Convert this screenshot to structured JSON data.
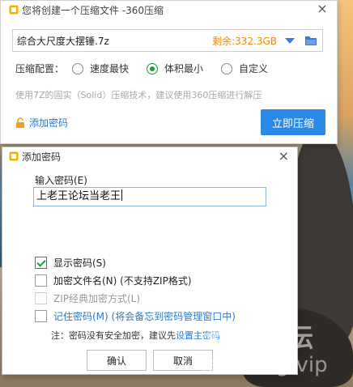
{
  "main_window": {
    "title": "您将创建一个压缩文件 -360压缩",
    "close": "×",
    "archive_name": "综合大尺度大摆锤.7z",
    "remaining_space": "剩余:332.3GB",
    "level_label": "压缩配置：",
    "levels": [
      {
        "label": "速度最快",
        "selected": false
      },
      {
        "label": "体积最小",
        "selected": true
      },
      {
        "label": "自定义",
        "selected": false
      }
    ],
    "hint": "使用7Z的固实（Solid）压缩技术，建议使用360压缩进行解压",
    "add_password_link": "添加密码",
    "compress_button": "立即压缩"
  },
  "password_dialog": {
    "title": "添加密码",
    "close": "×",
    "input_label": "输入密码(E)",
    "password_value": "上老王论坛当老王",
    "options": [
      {
        "label": "显示密码(S)",
        "checked": true,
        "disabled": false
      },
      {
        "label": "加密文件名(N) (不支持ZIP格式)",
        "checked": false,
        "disabled": false
      },
      {
        "label": "ZIP经典加密方式(L)",
        "checked": false,
        "disabled": true
      },
      {
        "label": "记住密码(M) (将会备忘到密码管理窗口中)",
        "checked": false,
        "disabled": false
      }
    ],
    "note_prefix": "注：密码没有安全加密，建议先",
    "note_link": "设置主密码",
    "ok_button": "确认",
    "cancel_button": "取消"
  },
  "watermark": {
    "line1": "老王论坛",
    "line2": "laowang.vip"
  },
  "colors": {
    "accent": "#2b8ae6",
    "remaining": "#f08a00",
    "check": "#1a9e3c",
    "link": "#2a7bd1"
  }
}
